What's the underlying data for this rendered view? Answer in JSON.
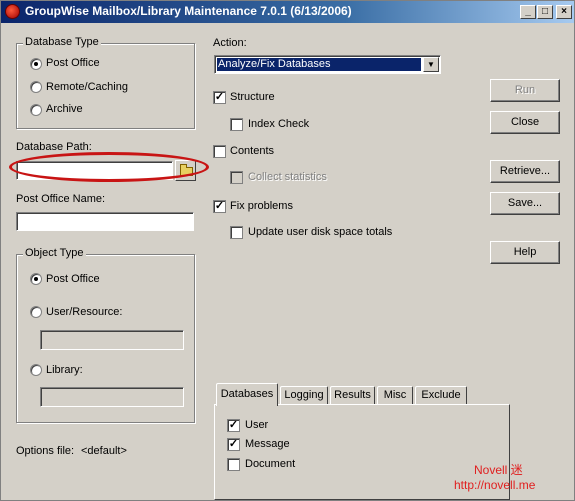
{
  "window": {
    "title": "GroupWise Mailbox/Library Maintenance 7.0.1 (6/13/2006)",
    "controls": {
      "minimize": "_",
      "maximize": "□",
      "close": "×"
    }
  },
  "database_type": {
    "label": "Database Type",
    "options": [
      "Post Office",
      "Remote/Caching",
      "Archive"
    ],
    "selected": "Post Office"
  },
  "database_path": {
    "label": "Database Path:",
    "value": ""
  },
  "post_office_name": {
    "label": "Post Office Name:",
    "value": ""
  },
  "object_type": {
    "label": "Object Type",
    "options": [
      "Post Office",
      "User/Resource:",
      "Library:"
    ],
    "selected": "Post Office"
  },
  "options_file": {
    "label": "Options file:",
    "value": "<default>"
  },
  "action": {
    "label": "Action:",
    "selected": "Analyze/Fix Databases"
  },
  "checks": {
    "structure": {
      "label": "Structure",
      "checked": true
    },
    "index_check": {
      "label": "Index Check",
      "checked": false
    },
    "contents": {
      "label": "Contents",
      "checked": false
    },
    "collect_statistics": {
      "label": "Collect statistics",
      "checked": false,
      "disabled": true
    },
    "fix_problems": {
      "label": "Fix problems",
      "checked": true
    },
    "update_disk_space": {
      "label": "Update user disk space totals",
      "checked": false
    }
  },
  "buttons": {
    "run": "Run",
    "close": "Close",
    "retrieve": "Retrieve...",
    "save": "Save...",
    "help": "Help"
  },
  "tabs": [
    "Databases",
    "Logging",
    "Results",
    "Misc",
    "Exclude"
  ],
  "active_tab": "Databases",
  "databases_tab": {
    "user": {
      "label": "User",
      "checked": true
    },
    "message": {
      "label": "Message",
      "checked": true
    },
    "document": {
      "label": "Document",
      "checked": false
    }
  },
  "watermark": {
    "line1": "Novell 迷",
    "line2": "http://novell.me"
  },
  "colors": {
    "titlebar": "#0a246a",
    "selection": "#0a246a",
    "highlight": "#c81414",
    "watermark": "#e02020"
  },
  "icons": {
    "app": "groupwise-icon",
    "browse": "folder-icon"
  }
}
